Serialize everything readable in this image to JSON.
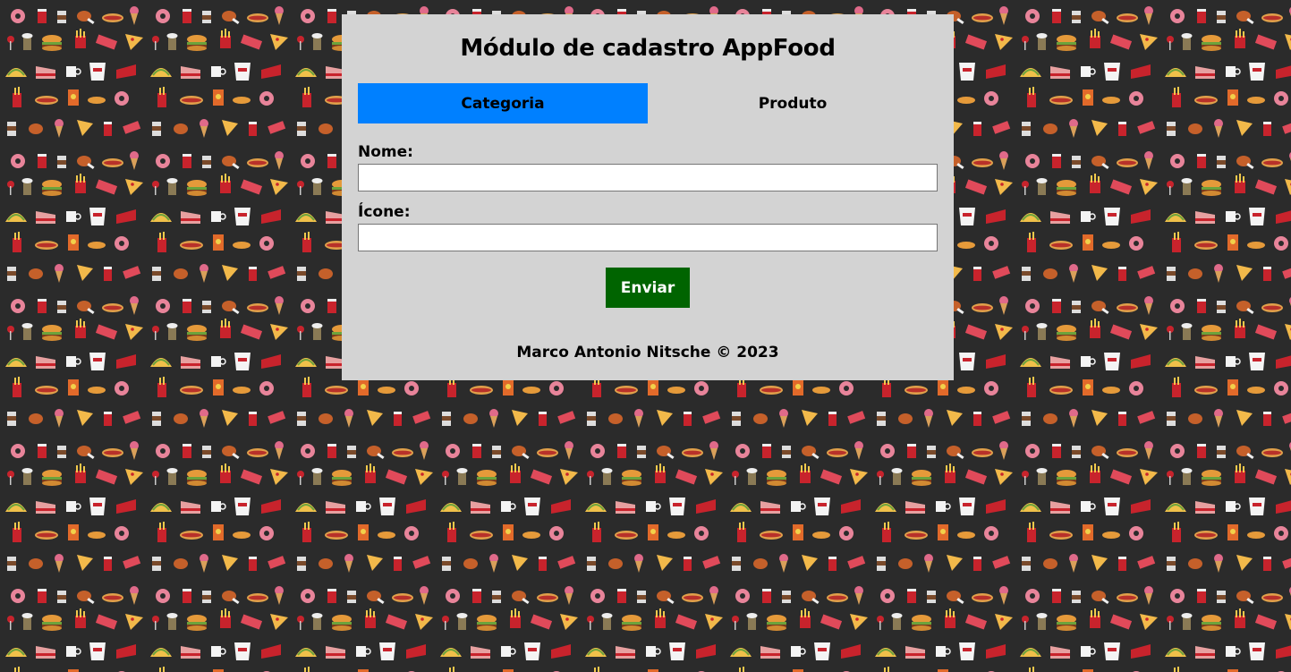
{
  "page": {
    "background_color": "#2b2b2b",
    "background_pattern": "food-doodle-pattern"
  },
  "form": {
    "title": "Módulo de cadastro AppFood",
    "tabs": [
      {
        "label": "Categoria",
        "active": true,
        "color": "#0080ff"
      },
      {
        "label": "Produto",
        "active": false
      }
    ],
    "fields": [
      {
        "label": "Nome:",
        "value": "",
        "placeholder": ""
      },
      {
        "label": "Ícone:",
        "value": "",
        "placeholder": ""
      }
    ],
    "submit": {
      "label": "Enviar",
      "color": "#006400"
    },
    "footer": "Marco Antonio Nitsche © 2023",
    "panel_color": "#d3d3d3"
  }
}
